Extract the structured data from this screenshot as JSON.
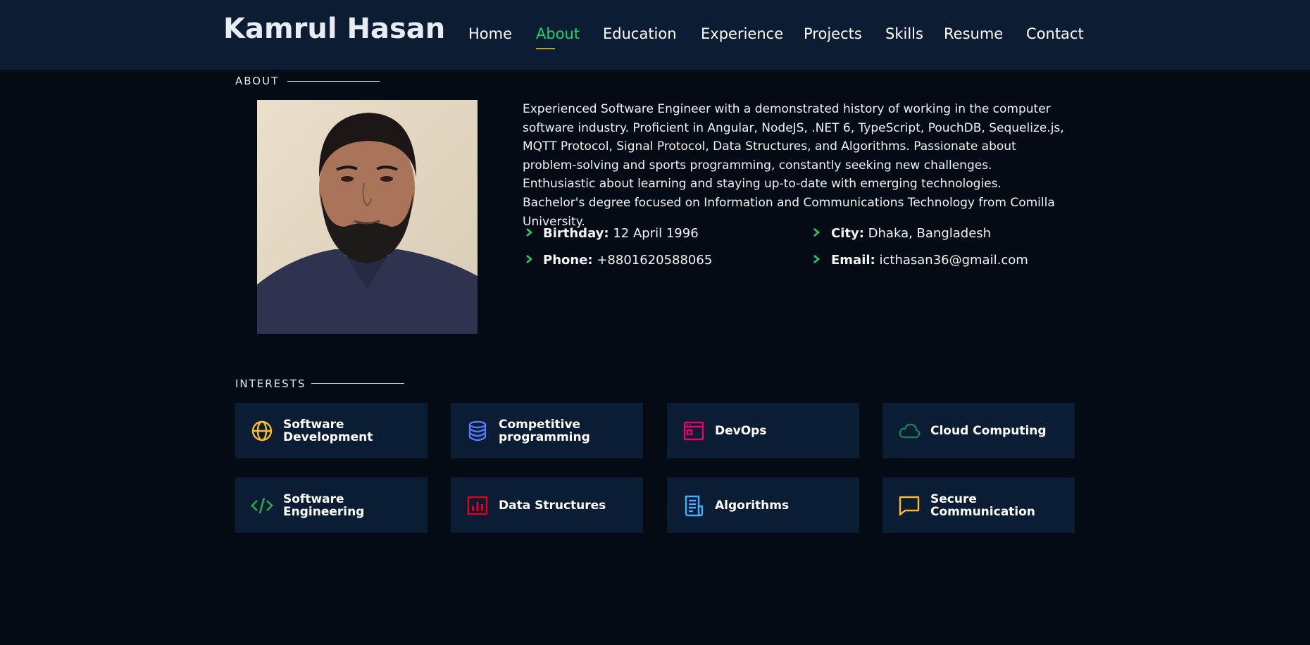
{
  "header": {
    "logo": "Kamrul Hasan",
    "nav": [
      {
        "label": "Home"
      },
      {
        "label": "About",
        "active": true
      },
      {
        "label": "Education"
      },
      {
        "label": "Experience"
      },
      {
        "label": "Projects"
      },
      {
        "label": "Skills"
      },
      {
        "label": "Resume"
      },
      {
        "label": "Contact"
      }
    ]
  },
  "about": {
    "title": "ABOUT",
    "description": "Experienced Software Engineer with a demonstrated history of working in the computer software industry. Proficient in Angular, NodeJS, .NET 6, TypeScript, PouchDB, Sequelize.js, MQTT Protocol, Signal Protocol, Data Structures, and Algorithms. Passionate about problem-solving and sports programming, constantly seeking new challenges. Enthusiastic about learning and staying up-to-date with emerging technologies. Bachelor's degree focused on Information and Communications Technology from Comilla University.",
    "info": {
      "birthday_label": "Birthday:",
      "birthday": "12 April 1996",
      "city_label": "City:",
      "city": "Dhaka, Bangladesh",
      "phone_label": "Phone:",
      "phone": "+8801620588065",
      "email_label": "Email:",
      "email": "icthasan36@gmail.com"
    }
  },
  "interests": {
    "title": "INTERESTS",
    "items": [
      {
        "label": "Software Development",
        "icon": "globe-icon",
        "color": "#ffbb2c"
      },
      {
        "label": "Competitive programming",
        "icon": "database-icon",
        "color": "#5578ff"
      },
      {
        "label": "DevOps",
        "icon": "browser-window-icon",
        "color": "#e80368"
      },
      {
        "label": "Cloud Computing",
        "icon": "cloud-icon",
        "color": "#1c7c54"
      },
      {
        "label": "Software Engineering",
        "icon": "code-icon",
        "color": "#28a745"
      },
      {
        "label": "Data Structures",
        "icon": "bar-chart-icon",
        "color": "#e2001a"
      },
      {
        "label": "Algorithms",
        "icon": "document-icon",
        "color": "#47aeff"
      },
      {
        "label": "Secure Communication",
        "icon": "chat-icon",
        "color": "#ffa76e"
      }
    ]
  },
  "colors": {
    "accent": "#18d26e",
    "header_bg": "#0b1c33",
    "page_bg": "#040b14",
    "card_bg": "#0b1d35"
  }
}
